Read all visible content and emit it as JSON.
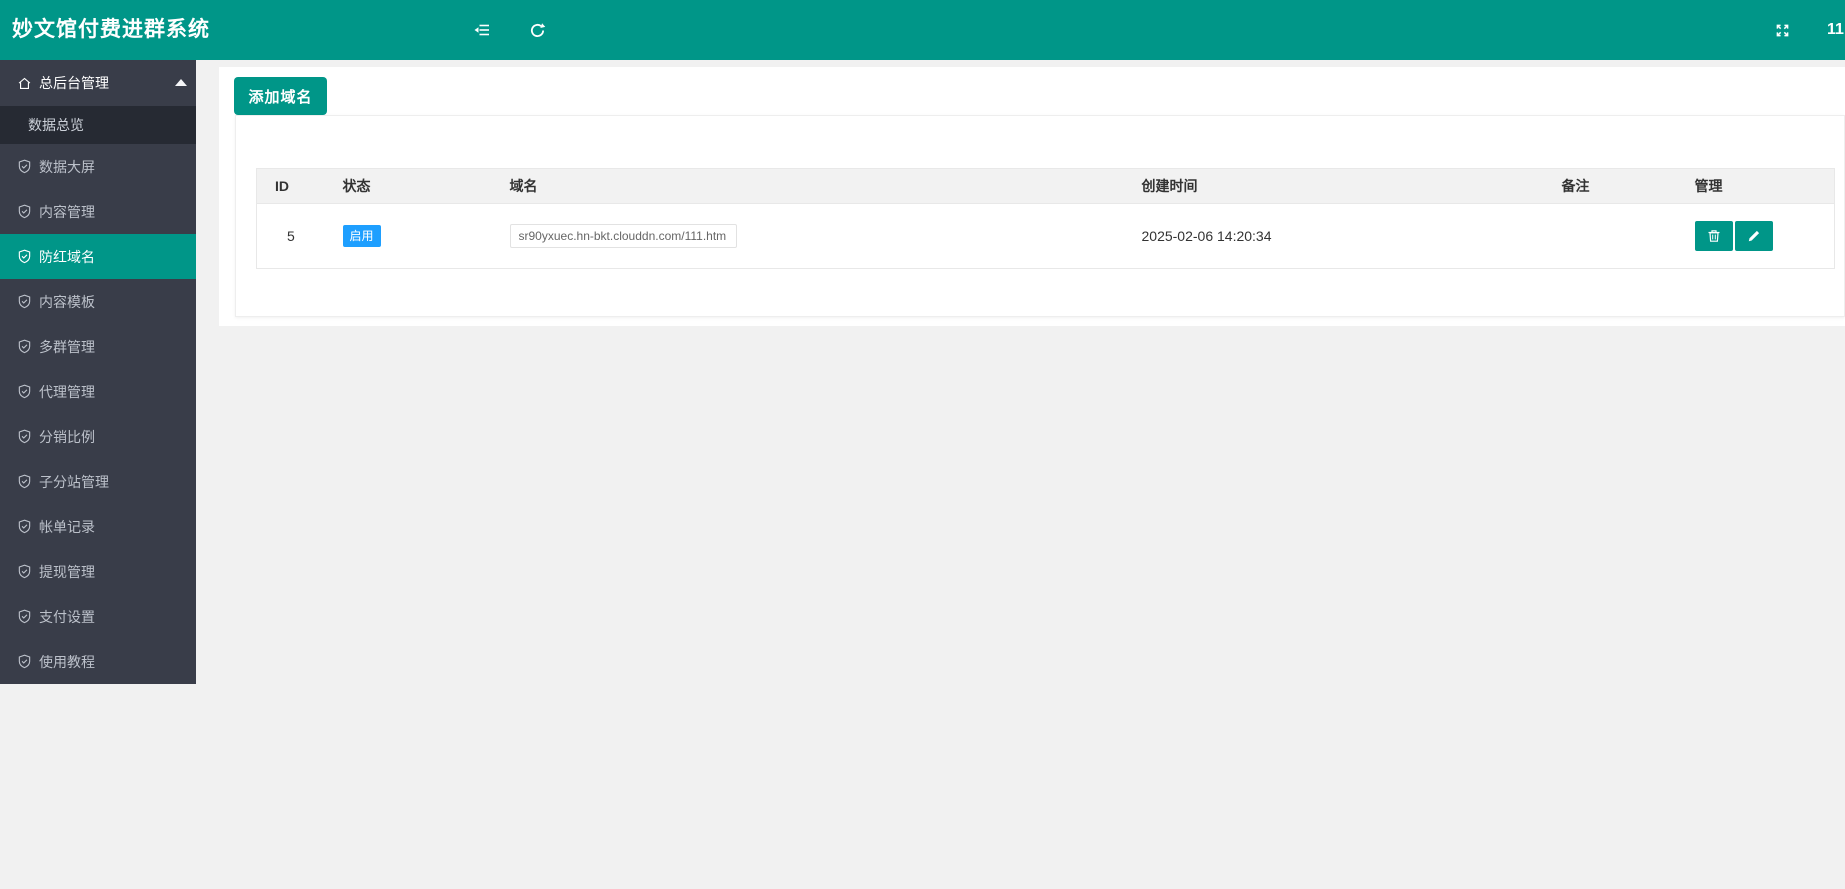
{
  "header": {
    "title": "妙文馆付费进群系统",
    "right_text": "11",
    "icons": [
      "collapse-sidebar-icon",
      "refresh-icon",
      "fullscreen-icon"
    ]
  },
  "sidebar": {
    "section": {
      "label": "总后台管理",
      "expanded": true
    },
    "child": {
      "label": "数据总览"
    },
    "items": [
      {
        "label": "数据大屏",
        "active": false
      },
      {
        "label": "内容管理",
        "active": false
      },
      {
        "label": "防红域名",
        "active": true
      },
      {
        "label": "内容模板",
        "active": false
      },
      {
        "label": "多群管理",
        "active": false
      },
      {
        "label": "代理管理",
        "active": false
      },
      {
        "label": "分销比例",
        "active": false
      },
      {
        "label": "子分站管理",
        "active": false
      },
      {
        "label": "帐单记录",
        "active": false
      },
      {
        "label": "提现管理",
        "active": false
      },
      {
        "label": "支付设置",
        "active": false
      },
      {
        "label": "使用教程",
        "active": false
      }
    ]
  },
  "main": {
    "add_button_label": "添加域名",
    "table": {
      "columns": [
        "ID",
        "状态",
        "域名",
        "创建时间",
        "备注",
        "管理"
      ],
      "rows": [
        {
          "id": "5",
          "status": "启用",
          "domain": "sr90yxuec.hn-bkt.clouddn.com/111.htm",
          "created_at": "2025-02-06 14:20:34",
          "remark": ""
        }
      ],
      "row_actions": [
        "delete",
        "edit"
      ]
    }
  },
  "colors": {
    "theme_teal": "#009688",
    "status_blue": "#1E9FFF",
    "sidebar_bg": "#393D49",
    "sidebar_child_bg": "#262a33",
    "page_bg": "#f1f1f1",
    "table_header_bg": "#f2f2f2"
  }
}
